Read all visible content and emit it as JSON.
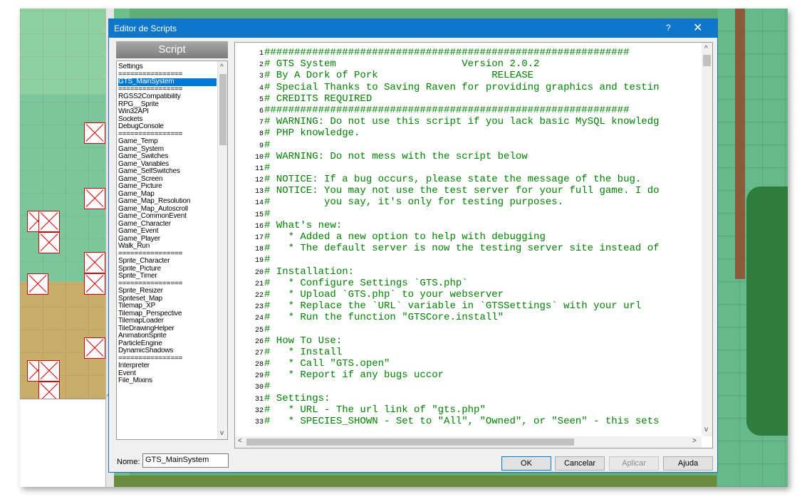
{
  "window": {
    "title": "Editor de Scripts",
    "help_glyph": "?",
    "close_glyph": "✕"
  },
  "script_list": {
    "header": "Script",
    "items": [
      "Settings",
      "================",
      "GTS_MainSystem",
      "================",
      "RGSS2Compatibility",
      "RPG__Sprite",
      "Win32API",
      "Sockets",
      "DebugConsole",
      "================",
      "Game_Temp",
      "Game_System",
      "Game_Switches",
      "Game_Variables",
      "Game_SelfSwitches",
      "Game_Screen",
      "Game_Picture",
      "Game_Map",
      "Game_Map_Resolution",
      "Game_Map_Autoscroll",
      "Game_CommonEvent",
      "Game_Character",
      "Game_Event",
      "Game_Player",
      "Walk_Run",
      "================",
      "Sprite_Character",
      "Sprite_Picture",
      "Sprite_Timer",
      "================",
      "Sprite_Resizer",
      "Spriteset_Map",
      "Tilemap_XP",
      "Tilemap_Perspective",
      "TilemapLoader",
      "TileDrawingHelper",
      "AnimationSprite",
      "ParticleEngine",
      "DynamicShadows",
      "================",
      "Interpreter",
      "Event",
      "File_Mixins"
    ],
    "selected_index": 2
  },
  "code_lines": [
    {
      "n": "1",
      "text": "#############################################################"
    },
    {
      "n": "2",
      "text": "# GTS System                     Version 2.0.2"
    },
    {
      "n": "3",
      "text": "# By A Dork of Pork                   RELEASE"
    },
    {
      "n": "4",
      "text": "# Special Thanks to Saving Raven for providing graphics and testin"
    },
    {
      "n": "5",
      "text": "# CREDITS REQUIRED"
    },
    {
      "n": "6",
      "text": "#############################################################"
    },
    {
      "n": "7",
      "text": "# WARNING: Do not use this script if you lack basic MySQL knowledg"
    },
    {
      "n": "8",
      "text": "# PHP knowledge."
    },
    {
      "n": "9",
      "text": "#"
    },
    {
      "n": "10",
      "text": "# WARNING: Do not mess with the script below"
    },
    {
      "n": "11",
      "text": "#"
    },
    {
      "n": "12",
      "text": "# NOTICE: If a bug occurs, please state the message of the bug."
    },
    {
      "n": "13",
      "text": "# NOTICE: You may not use the test server for your full game. I do"
    },
    {
      "n": "14",
      "text": "#         you say, it's only for testing purposes."
    },
    {
      "n": "15",
      "text": "#"
    },
    {
      "n": "16",
      "text": "# What's new:"
    },
    {
      "n": "17",
      "text": "#   * Added a new option to help with debugging"
    },
    {
      "n": "18",
      "text": "#   * The default server is now the testing server site instead of"
    },
    {
      "n": "19",
      "text": "#"
    },
    {
      "n": "20",
      "text": "# Installation:"
    },
    {
      "n": "21",
      "text": "#   * Configure Settings `GTS.php`"
    },
    {
      "n": "22",
      "text": "#   * Upload `GTS.php` to your webserver"
    },
    {
      "n": "23",
      "text": "#   * Replace the `URL` variable in `GTSSettings` with your url"
    },
    {
      "n": "24",
      "text": "#   * Run the function \"GTSCore.install\""
    },
    {
      "n": "25",
      "text": "#"
    },
    {
      "n": "26",
      "text": "# How To Use:"
    },
    {
      "n": "27",
      "text": "#   * Install"
    },
    {
      "n": "28",
      "text": "#   * Call \"GTS.open\""
    },
    {
      "n": "29",
      "text": "#   * Report if any bugs uccor"
    },
    {
      "n": "30",
      "text": "#"
    },
    {
      "n": "31",
      "text": "# Settings:"
    },
    {
      "n": "32",
      "text": "#   * URL - The url link of \"gts.php\""
    },
    {
      "n": "33",
      "text": "#   * SPECIES_SHOWN - Set to \"All\", \"Owned\", or \"Seen\" - this sets"
    }
  ],
  "footer": {
    "name_label": "Nome:",
    "name_value": "GTS_MainSystem",
    "ok_label": "OK",
    "cancel_label": "Cancelar",
    "apply_label": "Aplicar",
    "help_label": "Ajuda"
  },
  "colors": {
    "titlebar": "#0f77c9",
    "code_text": "#008000",
    "selection": "#0078d7"
  }
}
